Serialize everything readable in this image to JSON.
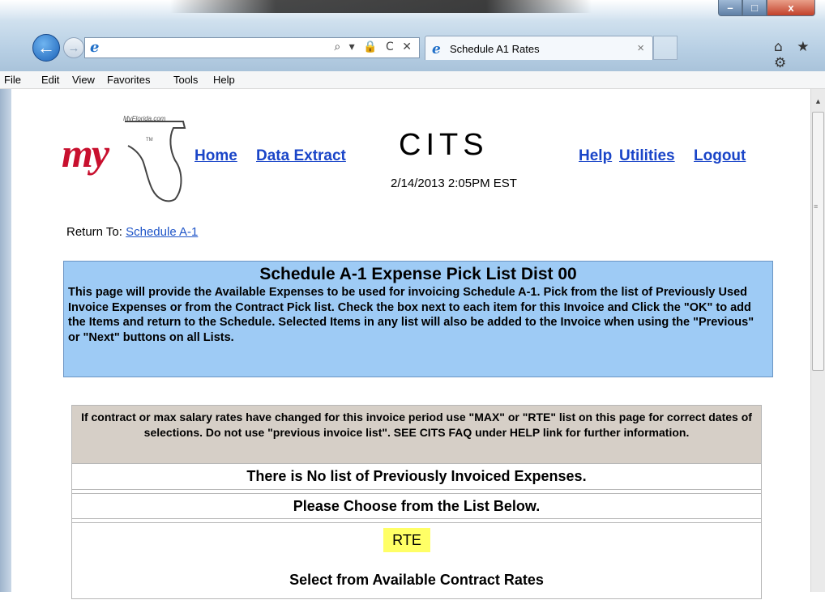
{
  "browser": {
    "address_value": "",
    "tab_title": "Schedule A1 Rates",
    "tab_close": "×",
    "window_buttons": {
      "minimize": "–",
      "maximize": "□",
      "close": "x"
    },
    "address_icons": "⌕ ▾ 🔒 C ✕",
    "toolbar_icons": "⌂ ★ ⚙"
  },
  "menu": [
    "File",
    "Edit",
    "View",
    "Favorites",
    "Tools",
    "Help"
  ],
  "header": {
    "logo_tagline": "MyFlorida.com",
    "logo_text": "my",
    "logo_tm": "TM",
    "nav_left": [
      "Home",
      "Data Extract"
    ],
    "site_title": "CITS",
    "datetime": "2/14/2013   2:05PM EST",
    "nav_right": [
      "Help",
      "Utilities",
      "Logout"
    ]
  },
  "return": {
    "label": "Return To:",
    "link": "Schedule A-1"
  },
  "info": {
    "title": "Schedule A-1 Expense Pick List Dist 00",
    "text": "This page will provide the Available Expenses to be used for invoicing Schedule A-1. Pick from the list of Previously Used Invoice Expenses or from the Contract Pick list.  Check the box next to each item for this Invoice and Click the \"OK\" to add the Items and return to the Schedule. Selected Items in any list will also be added to the Invoice when using the \"Previous\" or \"Next\" buttons on all Lists."
  },
  "notice": "If contract or max salary rates have changed for this invoice period use \"MAX\" or \"RTE\" list on this page for correct dates of selections.  Do not use \"previous invoice list\". SEE CITS FAQ under HELP link for further information.",
  "rows": {
    "none": "There is No list of Previously Invoiced Expenses.",
    "choose": "Please Choose from the List Below."
  },
  "rte": {
    "badge": "RTE",
    "subtitle": "Select from Available Contract Rates"
  },
  "colors": {
    "info_bg": "#9ecbf5",
    "notice_bg": "#d6cfc7",
    "link": "#1a45c8",
    "highlight": "#ffff66",
    "logo_red": "#c8102e"
  }
}
